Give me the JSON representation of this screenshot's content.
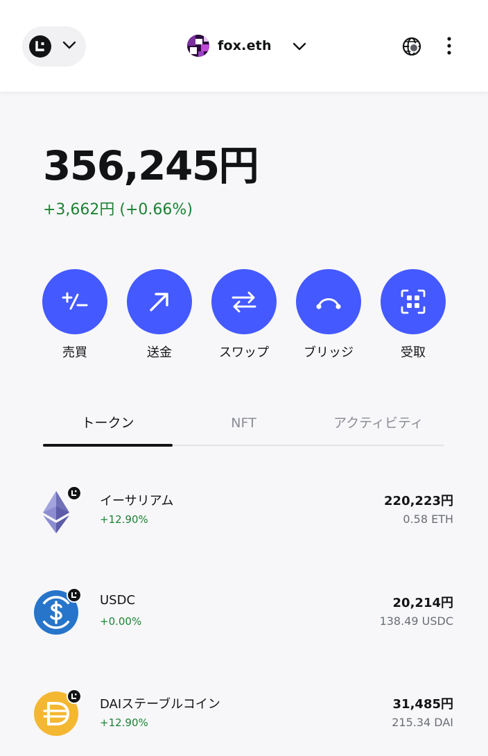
{
  "header": {
    "network_icon": "network-avatar-icon",
    "network_chevron_icon": "chevron-down-icon",
    "account": {
      "name": "fox.eth",
      "avatar_icon": "account-avatar-icon",
      "chevron_icon": "chevron-down-icon"
    },
    "globe_icon": "globe-connection-icon",
    "menu_icon": "more-vertical-icon"
  },
  "balance": {
    "total": "356,245円",
    "change": "+3,662円 (+0.66%)",
    "change_color": "#1c8234"
  },
  "actions": [
    {
      "label": "売買",
      "icon": "plus-minus-icon"
    },
    {
      "label": "送金",
      "icon": "arrow-up-right-icon"
    },
    {
      "label": "スワップ",
      "icon": "swap-arrows-icon"
    },
    {
      "label": "ブリッジ",
      "icon": "bridge-arc-icon"
    },
    {
      "label": "受取",
      "icon": "scan-qr-icon"
    }
  ],
  "accent_color": "#4459ff",
  "tabs": [
    {
      "label": "トークン",
      "active": true
    },
    {
      "label": "NFT",
      "active": false
    },
    {
      "label": "アクティビティ",
      "active": false
    }
  ],
  "tokens": [
    {
      "name": "イーサリアム",
      "change": "+12.90%",
      "fiat": "220,223円",
      "amount": "0.58 ETH",
      "icon": "ethereum-icon"
    },
    {
      "name": "USDC",
      "change": "+0.00%",
      "fiat": "20,214円",
      "amount": "138.49 USDC",
      "icon": "usdc-icon"
    },
    {
      "name": "DAIステーブルコイン",
      "change": "+12.90%",
      "fiat": "31,485円",
      "amount": "215.34 DAI",
      "icon": "dai-icon"
    }
  ]
}
